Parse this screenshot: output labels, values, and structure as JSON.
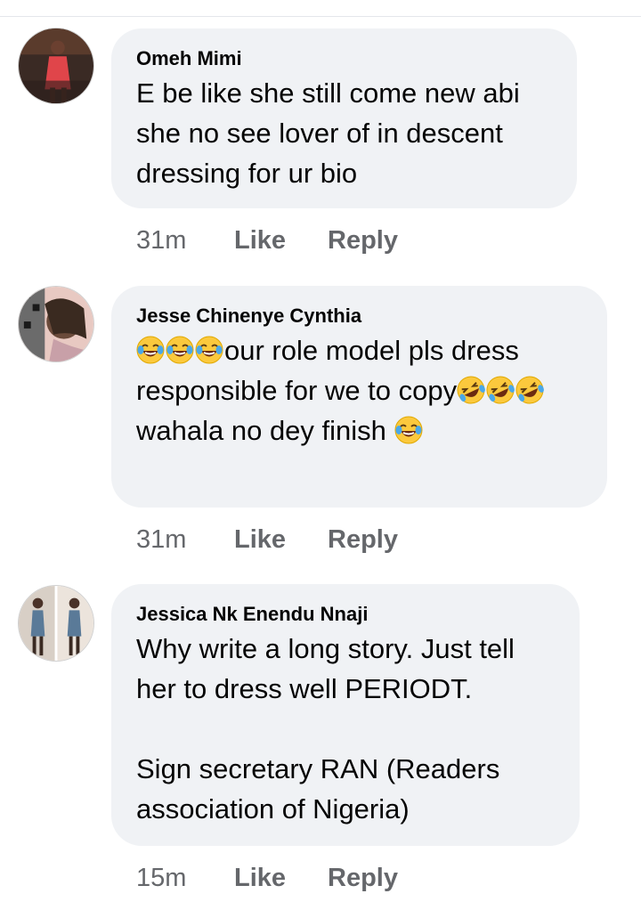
{
  "comments": [
    {
      "author": "Omeh Mimi",
      "text": "E be like she still come new abi she no see lover of in descent dressing for ur bio",
      "time": "31m",
      "like_label": "Like",
      "reply_label": "Reply"
    },
    {
      "author": "Jesse Chinenye Cynthia",
      "segments": {
        "a": "our role model pls dress responsible for we to copy",
        "b": " wahala no dey finish "
      },
      "time": "31m",
      "like_label": "Like",
      "reply_label": "Reply"
    },
    {
      "author": "Jessica Nk Enendu Nnaji",
      "text": "Why write a long story. Just tell her to dress well PERIODT.\n\nSign secretary RAN (Readers association of Nigeria)",
      "time": "15m",
      "like_label": "Like",
      "reply_label": "Reply"
    }
  ],
  "colors": {
    "bubble": "#f0f2f5",
    "meta_text": "#65676b",
    "body_text": "#050505"
  }
}
